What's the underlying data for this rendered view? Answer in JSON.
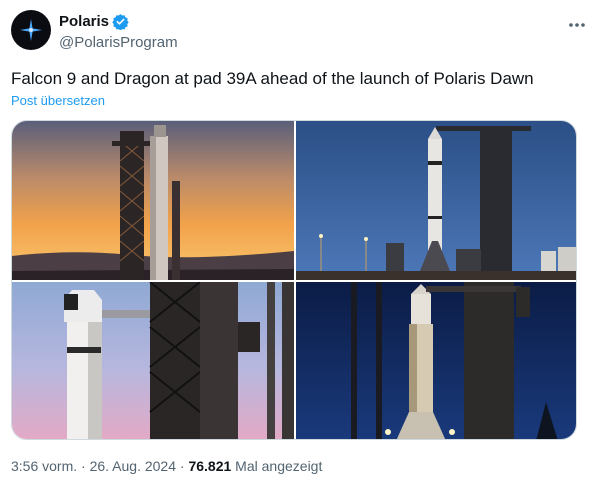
{
  "author": {
    "display_name": "Polaris",
    "handle": "@PolarisProgram",
    "verified": true,
    "avatar_icon": "star-logo-icon"
  },
  "tweet": {
    "text": "Falcon 9 and Dragon at pad 39A ahead of the launch of Polaris Dawn",
    "translate_label": "Post übersetzen"
  },
  "media": {
    "photo_count": 4
  },
  "meta": {
    "time": "3:56 vorm.",
    "separator_1": " · ",
    "date": "26. Aug. 2024",
    "separator_2": " · ",
    "views": "76.821",
    "views_label": " Mal angezeigt"
  },
  "colors": {
    "link": "#1d9bf0",
    "secondary_text": "#536471",
    "verified_badge": "#1d9bf0"
  }
}
